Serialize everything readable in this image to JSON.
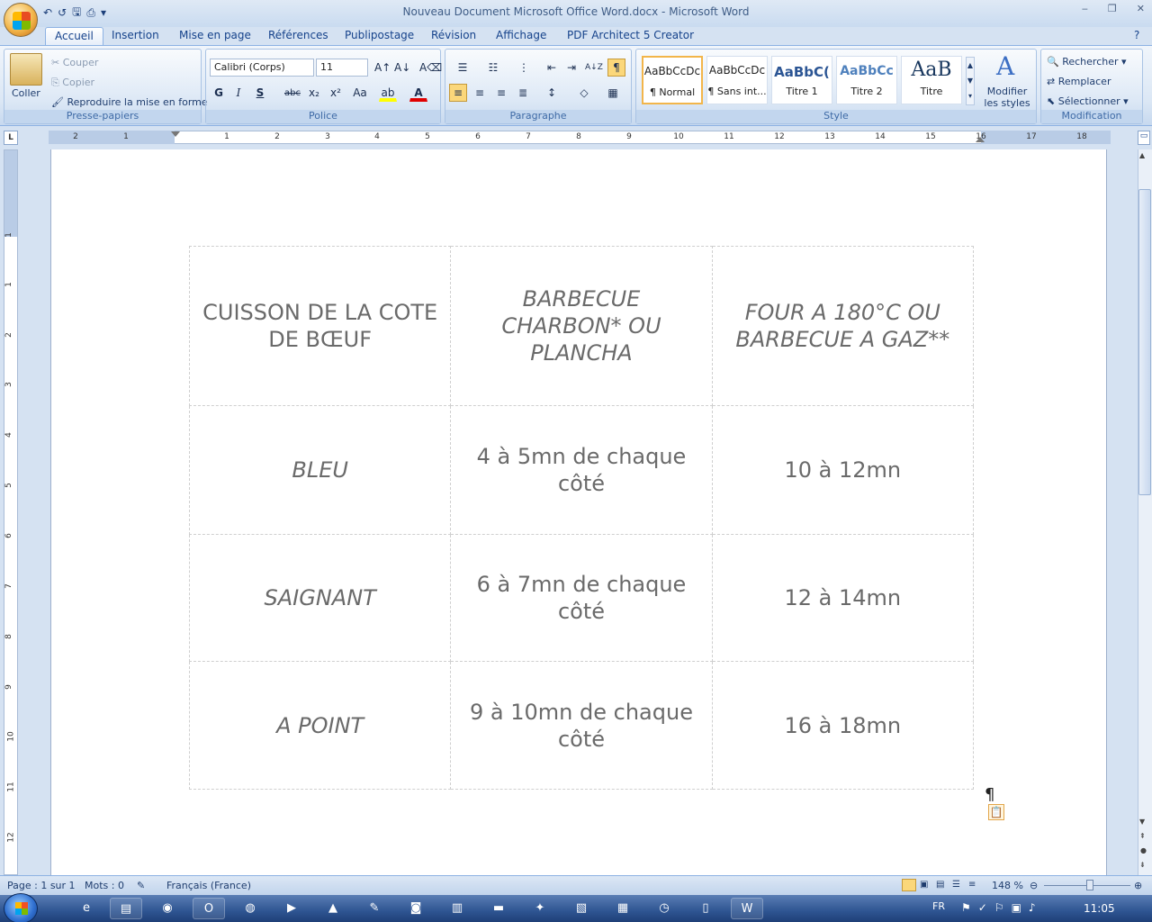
{
  "window": {
    "title": "Nouveau Document Microsoft Office Word.docx - Microsoft Word",
    "minimize": "‒",
    "maximize": "❐",
    "close": "✕"
  },
  "qat": {
    "undo": "↶",
    "redo": "↺",
    "save": "🖫",
    "print": "⎙",
    "more": "▾"
  },
  "tabs": [
    "Accueil",
    "Insertion",
    "Mise en page",
    "Références",
    "Publipostage",
    "Révision",
    "Affichage",
    "PDF Architect 5 Creator"
  ],
  "help": "?",
  "clipboard": {
    "paste": "Coller",
    "cut": "Couper",
    "copy": "Copier",
    "format_painter": "Reproduire la mise en forme",
    "label": "Presse-papiers"
  },
  "font": {
    "name": "Calibri (Corps)",
    "size": "11",
    "label": "Police",
    "bold": "G",
    "italic": "I",
    "underline": "S",
    "strike": "abc",
    "sub": "x₂",
    "sup": "x²",
    "case": "Aa",
    "grow": "A↑",
    "shrink": "A↓",
    "clear": "A⌫"
  },
  "paragraph": {
    "label": "Paragraphe",
    "pilcrow": "¶",
    "sort": "A↓Z"
  },
  "styles": {
    "label": "Style",
    "items": [
      {
        "preview": "AaBbCcDc",
        "name": "¶ Normal"
      },
      {
        "preview": "AaBbCcDc",
        "name": "¶ Sans int..."
      },
      {
        "preview": "AaBbC(",
        "name": "Titre 1"
      },
      {
        "preview": "AaBbCc",
        "name": "Titre 2"
      },
      {
        "preview": "AaB",
        "name": "Titre"
      }
    ],
    "modify": "Modifier les styles"
  },
  "editing": {
    "label": "Modification",
    "find": "Rechercher",
    "replace": "Remplacer",
    "select": "Sélectionner"
  },
  "ruler": {
    "h": [
      "2",
      "1",
      "1",
      "2",
      "3",
      "4",
      "5",
      "6",
      "7",
      "8",
      "9",
      "10",
      "11",
      "12",
      "13",
      "14",
      "15",
      "16",
      "17",
      "18"
    ],
    "v": [
      "1",
      "1",
      "2",
      "3",
      "4",
      "5",
      "6",
      "7",
      "8",
      "9",
      "10",
      "11",
      "12"
    ]
  },
  "table": {
    "rows": [
      [
        "CUISSON DE LA COTE DE BŒUF",
        "BARBECUE CHARBON* OU PLANCHA",
        "FOUR A 180°C OU BARBECUE A GAZ**"
      ],
      [
        "BLEU",
        "4 à 5mn de chaque côté",
        "10 à 12mn"
      ],
      [
        "SAIGNANT",
        "6 à 7mn de chaque côté",
        "12 à 14mn"
      ],
      [
        "A POINT",
        "9 à 10mn de chaque côté",
        "16 à 18mn"
      ]
    ]
  },
  "doc": {
    "pilcrow": "¶",
    "paste_icon": "📋"
  },
  "status": {
    "page": "Page : 1 sur 1",
    "words": "Mots : 0",
    "language": "Français (France)",
    "zoom": "148 %"
  },
  "taskbar": {
    "lang": "FR",
    "time": "11:05"
  }
}
